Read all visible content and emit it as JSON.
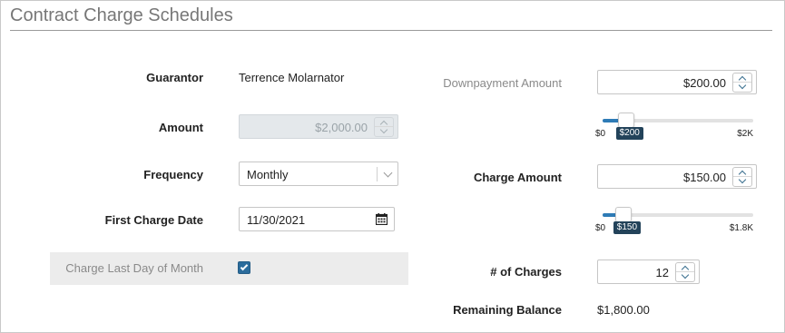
{
  "page": {
    "title": "Contract Charge Schedules"
  },
  "left": {
    "guarantor": {
      "label": "Guarantor",
      "value": "Terrence Molarnator"
    },
    "amount": {
      "label": "Amount",
      "value": "$2,000.00"
    },
    "frequency": {
      "label": "Frequency",
      "value": "Monthly"
    },
    "first_charge_date": {
      "label": "First Charge Date",
      "value": "11/30/2021"
    },
    "last_day": {
      "label": "Charge Last Day of Month",
      "checked": true
    }
  },
  "right": {
    "downpayment": {
      "label": "Downpayment Amount",
      "value": "$200.00",
      "slider": {
        "min_label": "$0",
        "max_label": "$2K",
        "bubble": "$200",
        "fraction": 0.1
      }
    },
    "charge_amount": {
      "label": "Charge Amount",
      "value": "$150.00",
      "slider": {
        "min_label": "$0",
        "max_label": "$1.8K",
        "bubble": "$150",
        "fraction": 0.083
      }
    },
    "num_charges": {
      "label": "# of Charges",
      "value": "12"
    },
    "remaining_balance": {
      "label": "Remaining Balance",
      "value": "$1,800.00"
    }
  },
  "colors": {
    "accent": "#2b6c9c",
    "bubble": "#23435a",
    "slider_fill": "#2e7bb6"
  }
}
